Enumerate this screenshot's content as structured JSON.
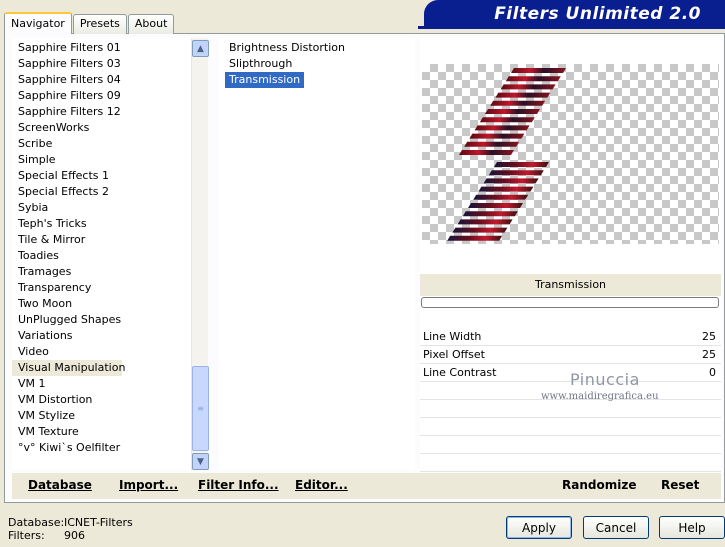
{
  "tabs": [
    "Navigator",
    "Presets",
    "About"
  ],
  "title": "Filters Unlimited 2.0",
  "categories": [
    "Sapphire Filters 01",
    "Sapphire Filters 03",
    "Sapphire Filters 04",
    "Sapphire Filters 09",
    "Sapphire Filters 12",
    "ScreenWorks",
    "Scribe",
    "Simple",
    "Special Effects 1",
    "Special Effects 2",
    "Sybia",
    "Teph's Tricks",
    "Tile & Mirror",
    "Toadies",
    "Tramages",
    "Transparency",
    "Two Moon",
    "UnPlugged Shapes",
    "Variations",
    "Video",
    "Visual Manipulation",
    "VM 1",
    "VM Distortion",
    "VM Stylize",
    "VM Texture",
    "°v° Kiwi`s Oelfilter"
  ],
  "selected_category": "Visual Manipulation",
  "filters": [
    "Brightness Distortion",
    "Slipthrough",
    "Transmission"
  ],
  "selected_filter": "Transmission",
  "preview_filter_name": "Transmission",
  "params": [
    {
      "label": "Line Width",
      "value": "25"
    },
    {
      "label": "Pixel Offset",
      "value": "25"
    },
    {
      "label": "Line Contrast",
      "value": "0"
    }
  ],
  "watermark": {
    "name": "Pinuccia",
    "site": "www.maidiregrafica.eu"
  },
  "bottom_buttons": {
    "database": "Database",
    "import": "Import...",
    "filter_info": "Filter Info...",
    "editor": "Editor...",
    "randomize": "Randomize",
    "reset": "Reset"
  },
  "status": {
    "database_label": "Database:",
    "database_value": "ICNET-Filters",
    "filters_label": "Filters:",
    "filters_value": "906"
  },
  "dialog_buttons": {
    "apply": "Apply",
    "cancel": "Cancel",
    "help": "Help"
  },
  "colors": {
    "banner": "#0a1f8f",
    "selection": "#316ac5",
    "panel": "#ece9d8"
  }
}
